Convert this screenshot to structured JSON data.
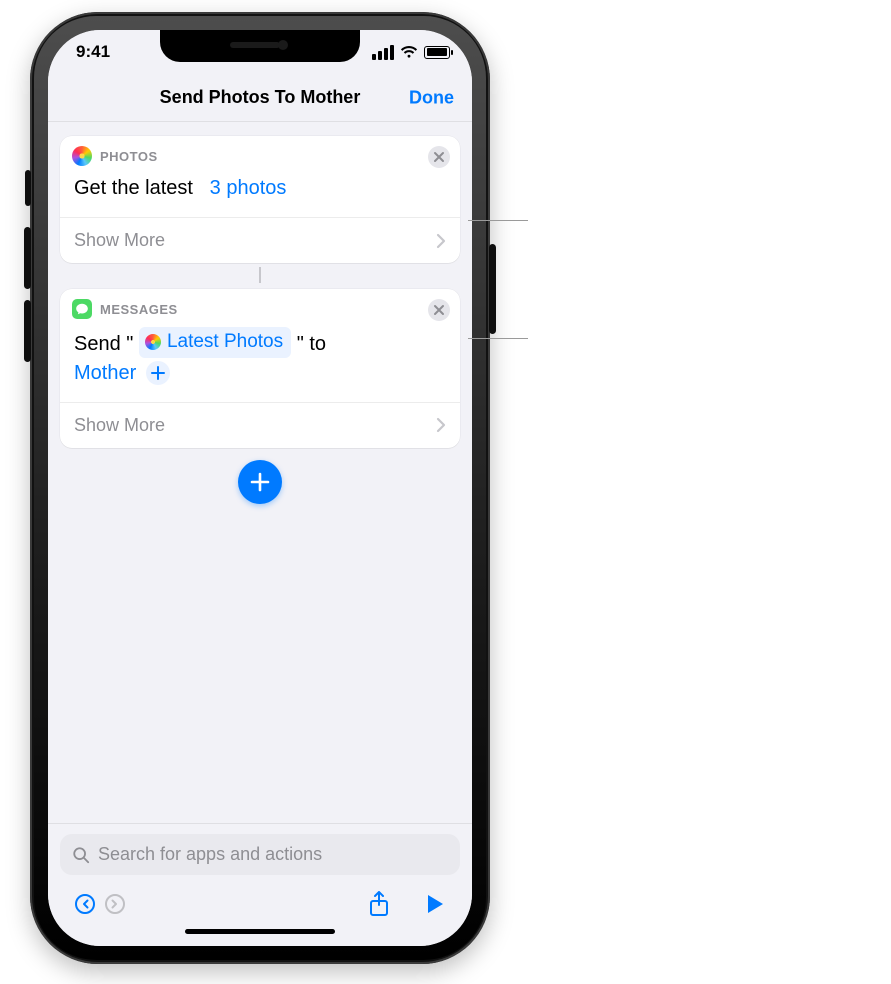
{
  "statusbar": {
    "time": "9:41"
  },
  "navbar": {
    "title": "Send Photos To Mother",
    "done": "Done"
  },
  "actions": {
    "photos": {
      "app_label": "PHOTOS",
      "line_prefix": "Get the latest",
      "param": "3 photos",
      "show_more": "Show More"
    },
    "messages": {
      "app_label": "MESSAGES",
      "send_prefix": "Send \"",
      "token_label": "Latest Photos",
      "send_mid": "\" to",
      "recipient": "Mother",
      "show_more": "Show More"
    }
  },
  "search": {
    "placeholder": "Search for apps and actions"
  },
  "icons": {
    "close": "close-icon",
    "chevron": "chevron-right-icon",
    "add": "plus-icon",
    "undo": "undo-icon",
    "redo": "redo-icon",
    "share": "share-icon",
    "play": "play-icon",
    "search": "search-icon",
    "signal": "cellular-signal-icon",
    "wifi": "wifi-icon",
    "battery": "battery-icon"
  }
}
